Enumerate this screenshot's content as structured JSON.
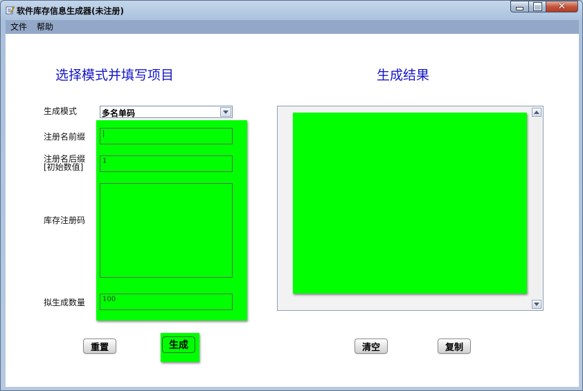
{
  "window": {
    "title": "软件库存信息生成器(未注册)"
  },
  "menu": {
    "items": [
      "文件",
      "帮助"
    ]
  },
  "left": {
    "heading": "选择模式并填写项目",
    "mode_label": "生成模式",
    "mode_value": "多名单码",
    "prefix_label": "注册名前缀",
    "prefix_value": "|",
    "suffix_label": "注册名后缀",
    "suffix_sublabel": "[初始数值]",
    "suffix_value": "1",
    "codes_label": "库存注册码",
    "codes_value": "",
    "count_label": "拟生成数量",
    "count_value": "100"
  },
  "right": {
    "heading": "生成结果",
    "output_value": ""
  },
  "buttons": {
    "reset": "重置",
    "generate": "生成",
    "clear": "清空",
    "copy": "复制"
  },
  "colors": {
    "highlight": "#00ff00",
    "heading": "#1515c8"
  }
}
